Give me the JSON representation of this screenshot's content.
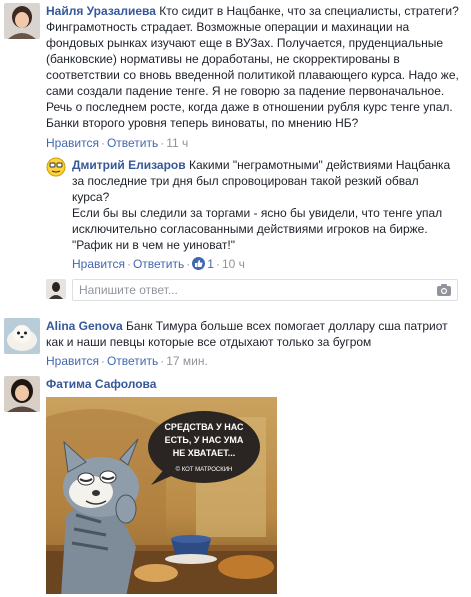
{
  "comments": [
    {
      "author": "Найля Уразалиева",
      "text": "Кто сидит в Нацбанке, что за специалисты, стратеги?\nФинграмотность страдает. Возможные операции и махинации на\nфондовых рынках изучают еще в ВУЗах. Получается, пруденциальные\n(банковские) нормативы не доработаны, не скорректированы в\nсоответствии со вновь введенной политикой плавающего курса. Надо же,\nсами создали падение тенге. Я не говорю за падение первоначальное.\nРечь о последнем росте, когда даже в отношении рубля курс тенге упал.\nБанки второго уровня теперь виноваты, по мнению НБ?",
      "like_label": "Нравится",
      "reply_label": "Ответить",
      "time": "11 ч"
    },
    {
      "author": "Дмитрий Елизаров",
      "text": "Какими \"неграмотными\" действиями Нацбанка\nза последние три дня был спровоцирован такой резкий обвал\nкурса?\nЕсли бы вы следили за торгами - ясно бы увидели, что тенге упал\nисключительно согласованными действиями игроков на бирже.\n\"Рафик ни в чем не уиноват!\"",
      "like_label": "Нравится",
      "reply_label": "Ответить",
      "like_count": "1",
      "time": "10 ч"
    },
    {
      "author": "Alina Genova",
      "text": "Банк Тимура больше всех помогает доллару сша патриот\nкак и наши певцы которые все отдыхают только за бугром",
      "like_label": "Нравится",
      "reply_label": "Ответить",
      "time": "17 мин."
    },
    {
      "author": "Фатима Сафолова",
      "image": {
        "caption_lines": [
          "СРЕДСТВА У НАС",
          "ЕСТЬ, У НАС УМА",
          "НЕ ХВАТАЕТ..."
        ],
        "signature": "© КОТ МАТРОСКИН"
      }
    }
  ],
  "reply_box": {
    "placeholder": "Напишите ответ..."
  },
  "separator": "·",
  "colors": {
    "link": "#4267b2",
    "author": "#365899",
    "meta": "#90949c",
    "like_badge": "#4267b2"
  },
  "icons": [
    "camera-icon",
    "like-icon"
  ]
}
